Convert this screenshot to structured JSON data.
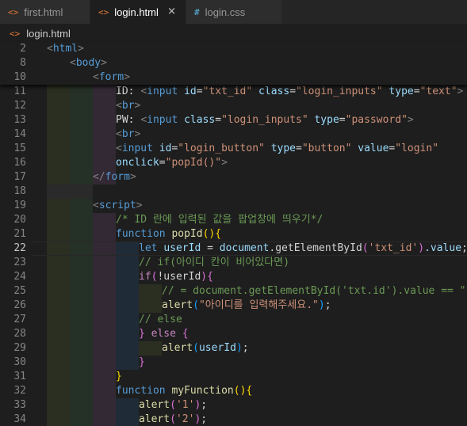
{
  "tabs": [
    {
      "icon": "<>",
      "label": "first.html"
    },
    {
      "icon": "<>",
      "label": "login.html",
      "close": "×"
    },
    {
      "icon": "#",
      "label": "login.css"
    }
  ],
  "breadcrumb": {
    "icon": "<>",
    "label": "login.html"
  },
  "sticky_lines": [
    {
      "num": "2",
      "indent": "",
      "text": "<html>"
    },
    {
      "num": "8",
      "indent": "    ",
      "text": "<body>"
    },
    {
      "num": "10",
      "indent": "        ",
      "text": "<form>"
    }
  ],
  "lines": [
    {
      "num": "11",
      "text": "ID: <input id=\"txt_id\" class=\"login_inputs\" type=\"text\">"
    },
    {
      "num": "12",
      "text": "<br>"
    },
    {
      "num": "13",
      "text": "PW: <input class=\"login_inputs\" type=\"password\">"
    },
    {
      "num": "14",
      "text": "<br>"
    },
    {
      "num": "15",
      "text": "<input id=\"login_button\" type=\"button\" value=\"login\""
    },
    {
      "num": "16",
      "text": "onclick=\"popId()\">"
    },
    {
      "num": "17",
      "text": "</form>"
    },
    {
      "num": "18",
      "text": ""
    },
    {
      "num": "19",
      "text": "<script>"
    },
    {
      "num": "20",
      "text": "/* ID 란에 입력된 값을 팝업창에 띄우기*/"
    },
    {
      "num": "21",
      "text": "function popId(){"
    },
    {
      "num": "22",
      "text": "let userId = document.getElementById('txt_id').value;"
    },
    {
      "num": "23",
      "text": "// if(아이디 칸이 비어있다면)"
    },
    {
      "num": "24",
      "text": "if(!userId){"
    },
    {
      "num": "25",
      "text": "// = document.getElementById('txt.id').value == \"\""
    },
    {
      "num": "26",
      "text": "alert(\"아이디를 입력해주세요.\");"
    },
    {
      "num": "27",
      "text": "// else"
    },
    {
      "num": "28",
      "text": "} else {"
    },
    {
      "num": "29",
      "text": "alert(userId);"
    },
    {
      "num": "30",
      "text": "}"
    },
    {
      "num": "31",
      "text": "}"
    },
    {
      "num": "32",
      "text": "function myFunction(){"
    },
    {
      "num": "33",
      "text": "alert('1');"
    },
    {
      "num": "34",
      "text": "alert('2');"
    }
  ],
  "colors": {
    "background": "#1e1e1e",
    "tag": "#569cd6",
    "attribute": "#9cdcfe",
    "string": "#ce9178",
    "function": "#dcdcaa",
    "comment": "#6a9955",
    "bracket_gold": "#ffd700",
    "bracket_purple": "#da70d6",
    "bracket_blue": "#179fff"
  }
}
